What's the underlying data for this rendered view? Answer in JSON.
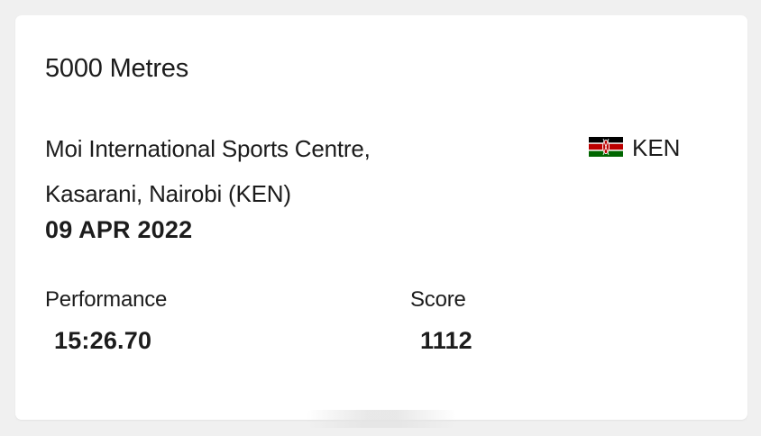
{
  "result": {
    "event": "5000 Metres",
    "venue_line1": "Moi International Sports Centre,",
    "venue_line2": "Kasarani, Nairobi (KEN)",
    "date": "09 APR 2022",
    "country": {
      "code": "KEN",
      "flag_icon": "kenya-flag-icon"
    },
    "performance_label": "Performance",
    "performance_value": "15:26.70",
    "score_label": "Score",
    "score_value": "1112"
  },
  "colors": {
    "background": "#f0f0f0",
    "card": "#ffffff",
    "text": "#1c1c1c",
    "flag_black": "#000000",
    "flag_red": "#bb0000",
    "flag_green": "#006600",
    "flag_white": "#ffffff"
  }
}
